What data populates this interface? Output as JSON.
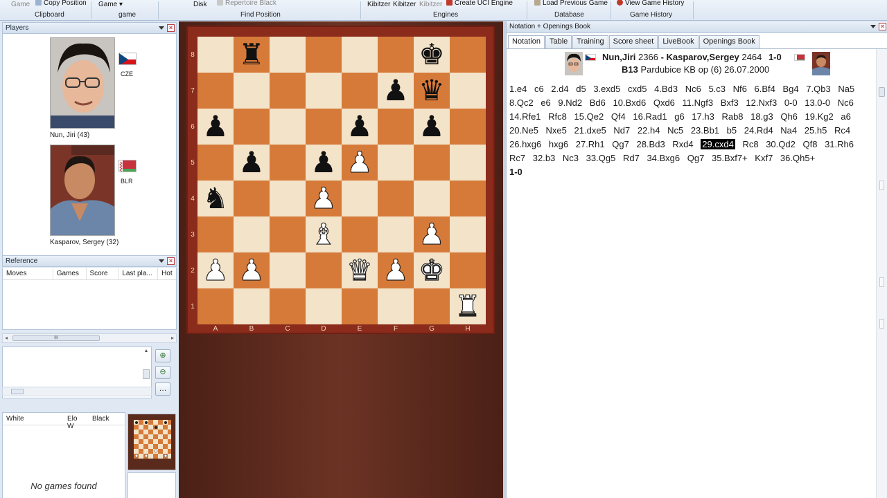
{
  "ribbon": {
    "items": [
      {
        "label": "Game",
        "dim": true
      },
      {
        "label": "Copy Position"
      },
      {
        "label": "Game ▾"
      },
      {
        "label": "Disk"
      },
      {
        "label": "Repertoire Black",
        "dim": true
      },
      {
        "label": "Kibitzer"
      },
      {
        "label": "Kibitzer"
      },
      {
        "label": "Kibitzer",
        "dim": true
      },
      {
        "label": "Create UCI Engine"
      },
      {
        "label": "Load Previous Game"
      },
      {
        "label": "View Game History"
      }
    ],
    "groups": [
      "Clipboard",
      "game",
      "Find Position",
      "Engines",
      "Database",
      "Game History"
    ]
  },
  "players_panel": {
    "title": "Players",
    "white": {
      "name": "Nun, Jiri  (43)",
      "federation": "CZE"
    },
    "black": {
      "name": "Kasparov, Sergey  (32)",
      "federation": "BLR"
    }
  },
  "reference_panel": {
    "title": "Reference",
    "columns": [
      "Moves",
      "Games",
      "Score",
      "Last pla...",
      "Hot"
    ],
    "scroll_mark": "III"
  },
  "games_list": {
    "columns": [
      "White",
      "Elo W",
      "Black"
    ],
    "empty_text": "No games found"
  },
  "board": {
    "ranks": [
      "8",
      "7",
      "6",
      "5",
      "4",
      "3",
      "2",
      "1"
    ],
    "files": [
      "A",
      "B",
      "C",
      "D",
      "E",
      "F",
      "G",
      "H"
    ],
    "position": [
      [
        "",
        "bR",
        "",
        "",
        "",
        "",
        "bK",
        ""
      ],
      [
        "",
        "",
        "",
        "",
        "",
        "bP",
        "bQ",
        ""
      ],
      [
        "bP",
        "",
        "",
        "",
        "bP",
        "",
        "bP",
        ""
      ],
      [
        "",
        "bP",
        "",
        "bP",
        "wP",
        "",
        "",
        ""
      ],
      [
        "bN",
        "",
        "",
        "wP",
        "",
        "",
        "",
        ""
      ],
      [
        "",
        "",
        "",
        "wB",
        "",
        "",
        "wP",
        ""
      ],
      [
        "wP",
        "wP",
        "",
        "",
        "wQ",
        "wP",
        "wK",
        ""
      ],
      [
        "",
        "",
        "",
        "",
        "",
        "",
        "",
        "wR"
      ]
    ]
  },
  "notation": {
    "panel_title": "Notation + Openings Book",
    "tabs": [
      "Notation",
      "Table",
      "Training",
      "Score sheet",
      "LiveBook",
      "Openings Book"
    ],
    "active_tab": 0,
    "header": {
      "white": "Nun,Jiri",
      "white_elo": "2366",
      "dash": " - ",
      "black": "Kasparov,Sergey",
      "black_elo": "2464",
      "result": "1-0",
      "eco": "B13",
      "event": "Pardubice KB op (6) 26.07.2000"
    },
    "moves": [
      "1.e4",
      "c6",
      "2.d4",
      "d5",
      "3.exd5",
      "cxd5",
      "4.Bd3",
      "Nc6",
      "5.c3",
      "Nf6",
      "6.Bf4",
      "Bg4",
      "7.Qb3",
      "Na5",
      "8.Qc2",
      "e6",
      "9.Nd2",
      "Bd6",
      "10.Bxd6",
      "Qxd6",
      "11.Ngf3",
      "Bxf3",
      "12.Nxf3",
      "0-0",
      "13.0-0",
      "Nc6",
      "14.Rfe1",
      "Rfc8",
      "15.Qe2",
      "Qf4",
      "16.Rad1",
      "g6",
      "17.h3",
      "Rab8",
      "18.g3",
      "Qh6",
      "19.Kg2",
      "a6",
      "20.Ne5",
      "Nxe5",
      "21.dxe5",
      "Nd7",
      "22.h4",
      "Nc5",
      "23.Bb1",
      "b5",
      "24.Rd4",
      "Na4",
      "25.h5",
      "Rc4",
      "26.hxg6",
      "hxg6",
      "27.Rh1",
      "Qg7",
      "28.Bd3",
      "Rxd4",
      "29.cxd4",
      "Rc8",
      "30.Qd2",
      "Qf8",
      "31.Rh6",
      "Rc7",
      "32.b3",
      "Nc3",
      "33.Qg5",
      "Rd7",
      "34.Bxg6",
      "Qg7",
      "35.Bxf7+",
      "Kxf7",
      "36.Qh5+"
    ],
    "selected_move": "29.cxd4",
    "result": "1-0"
  },
  "colors": {
    "light_square": "#f3e3c8",
    "dark_square": "#d67a3a",
    "board_frame": "#8a2b1c",
    "wood": "#5a2a1c",
    "panel_bg": "#dfe8f3"
  }
}
